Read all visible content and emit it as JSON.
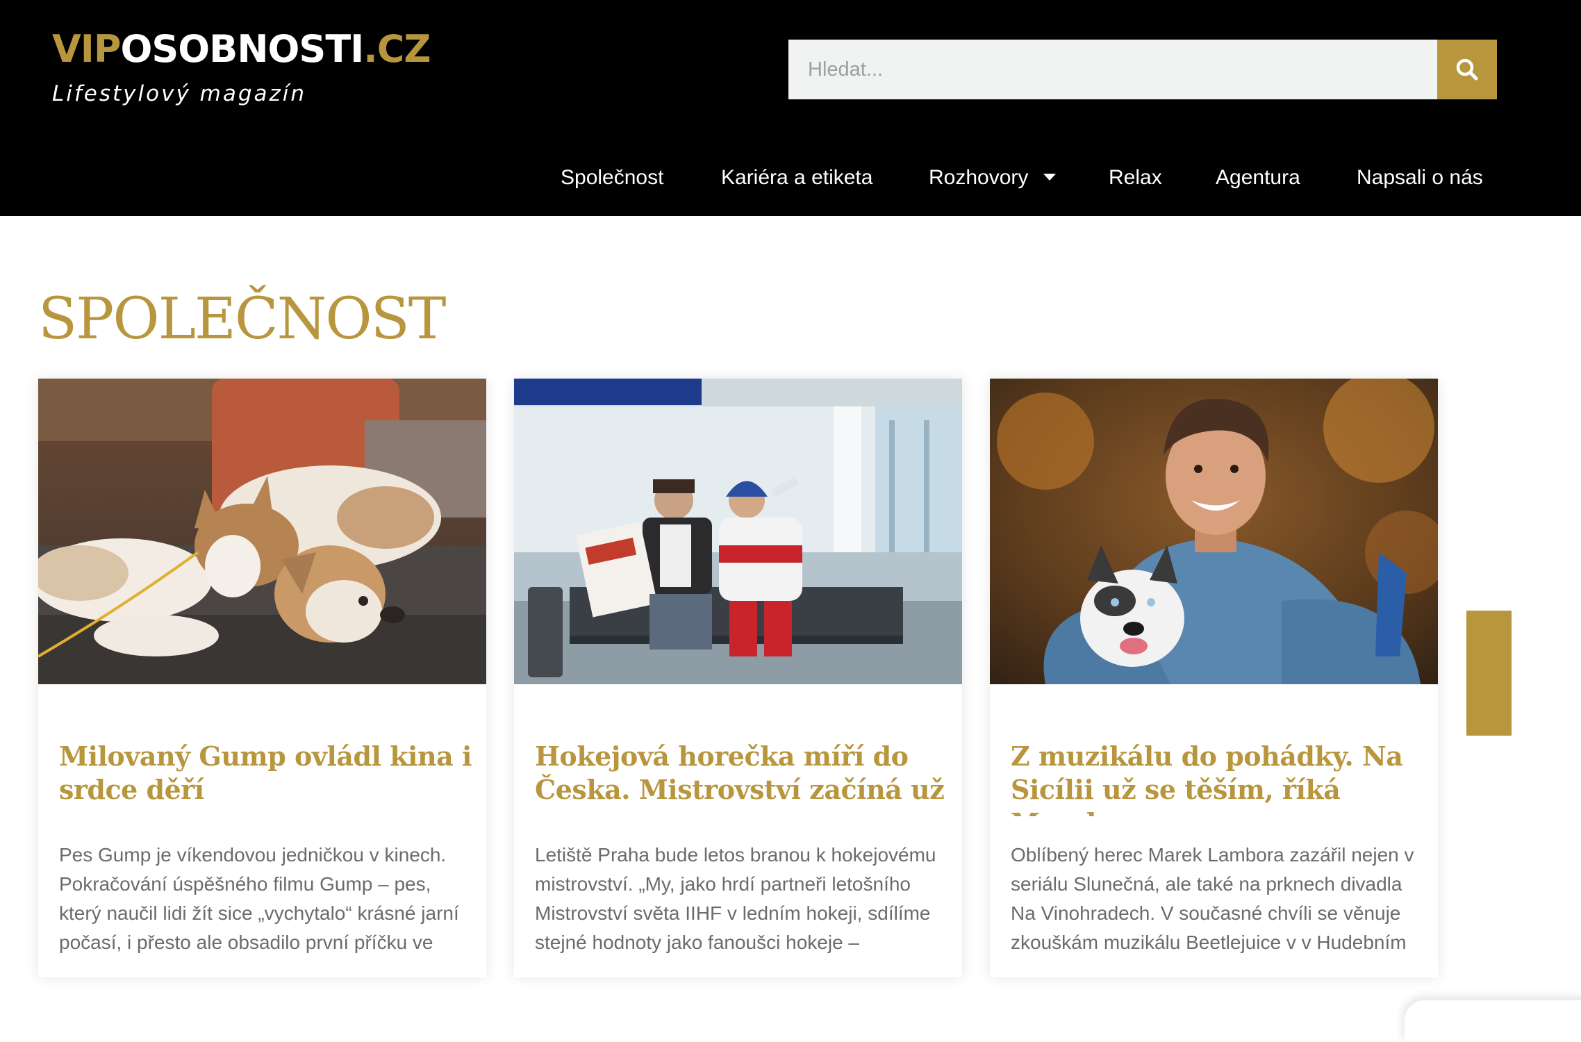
{
  "header": {
    "logo": {
      "part1": "VIP",
      "part2": "OSOBNOSTI",
      "part3": ".CZ"
    },
    "tagline": "Lifestylový magazín",
    "search": {
      "placeholder": "Hledat...",
      "value": ""
    },
    "nav": [
      {
        "label": "Společnost"
      },
      {
        "label": "Kariéra a etiketa"
      },
      {
        "label": "Rozhovory",
        "has_dropdown": true
      },
      {
        "label": "Relax"
      },
      {
        "label": "Agentura"
      },
      {
        "label": "Napsali o nás"
      }
    ]
  },
  "colors": {
    "accent_gold": "#b8963e",
    "header_bg": "#000000",
    "excerpt_gray": "#6b6b6b",
    "search_bg": "#f1f3f2"
  },
  "icons": {
    "search": "search-icon",
    "dropdown": "chevron-down-icon"
  },
  "section": {
    "title": "SPOLEČNOST",
    "cards": [
      {
        "image": "two dogs resting on a sofa",
        "title": "Milovaný Gump ovládl kina i srdce děří",
        "excerpt": "Pes Gump je víkendovou jedničkou v kinech. Pokračování úspěšného filmu Gump – pes, který naučil lidi žít sice „vychytalo“ krásné jarní počasí, i přesto ale obsadilo první příčku ve"
      },
      {
        "image": "man with newspaper and hockey fan at airport",
        "title": "Hokejová horečka míří do Česka. Mistrovství začíná už na",
        "excerpt": "Letiště Praha  bude letos branou k hokejovému mistrovství. „My, jako hrdí partneři letošního Mistrovství světa IIHF v ledním hokeji, sdílíme stejné hodnoty jako fanoušci hokeje –"
      },
      {
        "image": "smiling young man with a husky dog",
        "title": "Z muzikálu do pohádky. Na Sicílii už se těším, říká Marek",
        "excerpt": "Oblíbený herec Marek Lambora zazářil nejen v seriálu Slunečná, ale také na prknech divadla Na Vinohradech. V současné chvíli se věnuje zkouškám muzikálu Beetlejuice v v Hudebním"
      }
    ]
  }
}
